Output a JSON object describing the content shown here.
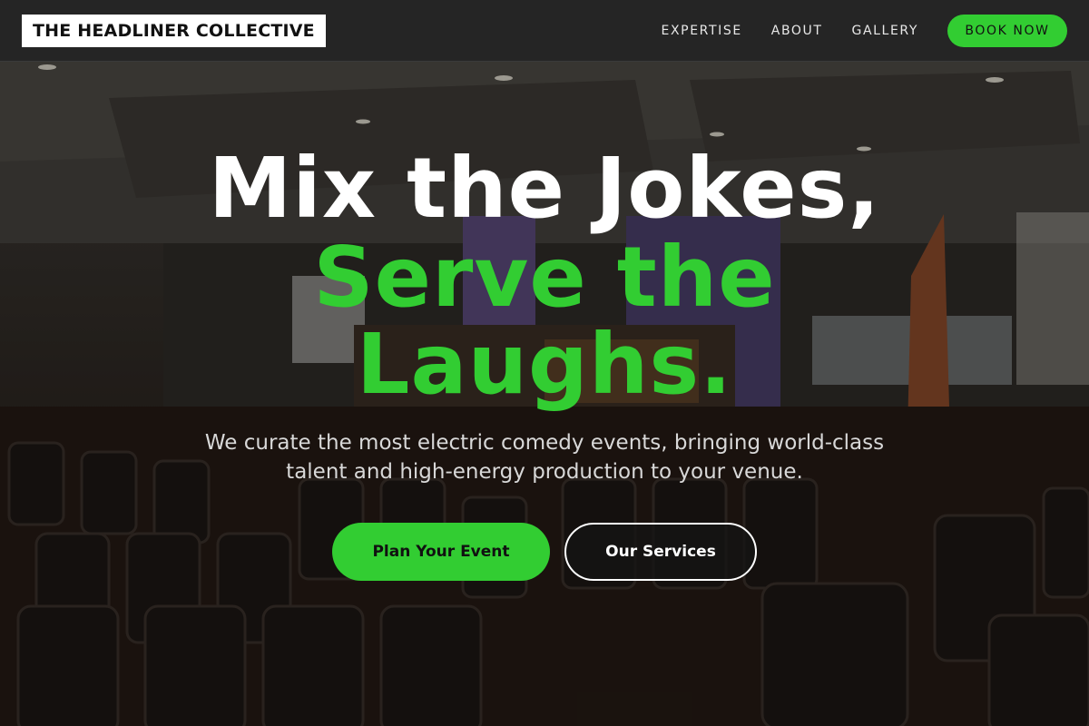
{
  "brand": {
    "name": "THE HEADLINER COLLECTIVE"
  },
  "nav": {
    "links": [
      "EXPERTISE",
      "ABOUT",
      "GALLERY"
    ],
    "cta": "BOOK NOW"
  },
  "hero": {
    "headline_line1": "Mix the Jokes,",
    "headline_line2": "Serve the",
    "headline_line3": "Laughs.",
    "subtitle": "We curate the most electric comedy events, bringing world-class talent and high-energy production to your venue.",
    "primary_button": "Plan Your Event",
    "secondary_button": "Our Services"
  },
  "colors": {
    "accent": "#32cd32",
    "header_bg": "#252525",
    "logo_bg": "#ffffff"
  }
}
